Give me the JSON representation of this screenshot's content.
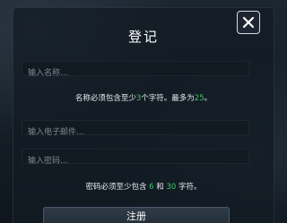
{
  "dialog": {
    "title": "登记",
    "close_icon": "close-icon"
  },
  "name_field": {
    "placeholder": "输入名称...",
    "value": ""
  },
  "name_hint": {
    "part1": "名称必须包含至少",
    "min": "3",
    "part2": "个字符。最多为",
    "max": "25",
    "part3": "。"
  },
  "email_field": {
    "placeholder": "输入电子邮件...",
    "value": ""
  },
  "password_field": {
    "placeholder": "输入密码...",
    "value": ""
  },
  "password_hint": {
    "part1": "密码必须至少包含 ",
    "min": "6",
    "part2": " 和 ",
    "max": "30",
    "part3": " 字符。"
  },
  "submit_button": {
    "label": "注册"
  },
  "colors": {
    "highlight": "#3cc86a",
    "text": "#e9edf0",
    "placeholder": "#7d8790"
  }
}
